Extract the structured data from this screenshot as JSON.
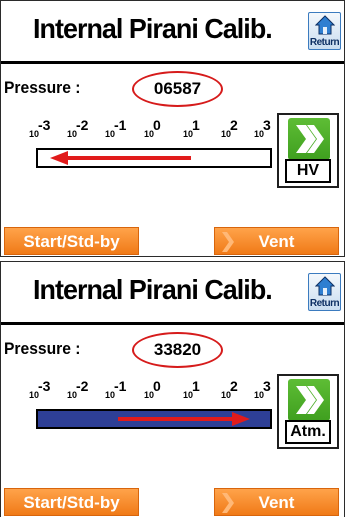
{
  "colors": {
    "accent_orange": "#f58a22",
    "ellipse_red": "#d61b1b",
    "bar_fill_blue": "#2e3f96",
    "arrow_red": "#e11b1b",
    "icon_green": "#4fae2a"
  },
  "screens": [
    {
      "title": "Internal Pirani Calib.",
      "return_label": "Return",
      "return_icon": "home-icon",
      "pressure_label": "Pressure :",
      "pressure_value": "06587",
      "scale_ticks": [
        {
          "base": "10",
          "exp": "-3"
        },
        {
          "base": "10",
          "exp": "-2"
        },
        {
          "base": "10",
          "exp": "-1"
        },
        {
          "base": "10",
          "exp": "0"
        },
        {
          "base": "10",
          "exp": "1"
        },
        {
          "base": "10",
          "exp": "2"
        },
        {
          "base": "10",
          "exp": "3"
        }
      ],
      "bar_filled": false,
      "arrow_direction": "left",
      "mode_icon": "double-chevron-right-icon",
      "mode_label": "HV",
      "start_label": "Start/Std-by",
      "vent_label": "Vent"
    },
    {
      "title": "Internal Pirani Calib.",
      "return_label": "Return",
      "return_icon": "home-icon",
      "pressure_label": "Pressure :",
      "pressure_value": "33820",
      "scale_ticks": [
        {
          "base": "10",
          "exp": "-3"
        },
        {
          "base": "10",
          "exp": "-2"
        },
        {
          "base": "10",
          "exp": "-1"
        },
        {
          "base": "10",
          "exp": "0"
        },
        {
          "base": "10",
          "exp": "1"
        },
        {
          "base": "10",
          "exp": "2"
        },
        {
          "base": "10",
          "exp": "3"
        }
      ],
      "bar_filled": true,
      "arrow_direction": "right",
      "mode_icon": "double-chevron-right-icon",
      "mode_label": "Atm.",
      "start_label": "Start/Std-by",
      "vent_label": "Vent"
    }
  ]
}
